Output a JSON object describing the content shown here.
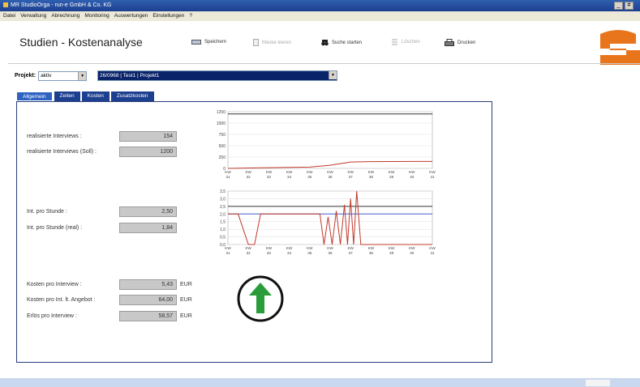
{
  "window": {
    "title": "MR StudioOrga - run-e GmbH & Co. KG",
    "controls": [
      "_",
      "#"
    ]
  },
  "menu": [
    "Datei",
    "Verwaltung",
    "Abrechnung",
    "Monitoring",
    "Auswertungen",
    "Einstellungen",
    "?"
  ],
  "page_title": "Studien - Kostenanalyse",
  "toolbar": {
    "save": "Speichern",
    "clear_mask": "Maske leeren",
    "search": "Suche starten",
    "delete": "Löschen",
    "print": "Drucken"
  },
  "project": {
    "label": "Projekt:",
    "status": "aktiv",
    "selection": "26/0968 | Test1 | Projekt1"
  },
  "tabs": [
    "Allgemein",
    "Zeiten",
    "Kosten",
    "Zusatzkosten"
  ],
  "fields": {
    "interviews_real": {
      "label": "realisierte Interviews :",
      "value": "154"
    },
    "interviews_target": {
      "label": "realisierte Interviews (Soll) :",
      "value": "1200"
    },
    "int_per_hour": {
      "label": "Int. pro Stunde :",
      "value": "2,50"
    },
    "int_per_hour_real": {
      "label": "Int. pro Stunde (real) :",
      "value": "1,84"
    },
    "cost_per_interview": {
      "label": "Kosten pro Interview :",
      "value": "5,43",
      "unit": "EUR"
    },
    "cost_per_offer": {
      "label": "Kosten pro Int. lt. Angebot :",
      "value": "64,00",
      "unit": "EUR"
    },
    "revenue_per_interview": {
      "label": "Erlös pro Interview :",
      "value": "58,57",
      "unit": "EUR"
    }
  },
  "trend_icon": "arrow-up-icon",
  "colors": {
    "accent": "#e8741c",
    "trend": "#2a9d3a",
    "tab": "#1d3f8f"
  },
  "chart_data": [
    {
      "type": "line",
      "categories": [
        "KW 31",
        "KW 32",
        "KW 33",
        "KW 34",
        "KW 35",
        "KW 36",
        "KW 37",
        "KW 38",
        "KW 39",
        "KW 40",
        "KW 41"
      ],
      "x_tick_labels": [
        [
          "KW",
          "31"
        ],
        [
          "KW",
          "32"
        ],
        [
          "KW",
          "33"
        ],
        [
          "KW",
          "34"
        ],
        [
          "KW",
          "35"
        ],
        [
          "KW",
          "36"
        ],
        [
          "KW",
          "37"
        ],
        [
          "KW",
          "38"
        ],
        [
          "KW",
          "39"
        ],
        [
          "KW",
          "40"
        ],
        [
          "KW",
          "41"
        ]
      ],
      "ylim": [
        0,
        1250
      ],
      "yticks": [
        "1250",
        "1000",
        "750",
        "500",
        "250",
        "0"
      ],
      "ytick_values": [
        1250,
        1000,
        750,
        500,
        250,
        0
      ],
      "series": [
        {
          "color": "#333333",
          "values": [
            1200,
            1200,
            1200,
            1200,
            1200,
            1200,
            1200,
            1200,
            1200,
            1200,
            1200
          ]
        },
        {
          "color": "#c0392b",
          "values": [
            0,
            8,
            15,
            22,
            30,
            70,
            140,
            150,
            152,
            154,
            154
          ]
        }
      ]
    },
    {
      "type": "line",
      "categories": [
        "KW 31",
        "KW 32",
        "KW 33",
        "KW 34",
        "KW 35",
        "KW 36",
        "KW 37",
        "KW 38",
        "KW 39",
        "KW 40",
        "KW 41"
      ],
      "x_tick_labels": [
        [
          "KW",
          "31"
        ],
        [
          "KW",
          "32"
        ],
        [
          "KW",
          "33"
        ],
        [
          "KW",
          "34"
        ],
        [
          "KW",
          "35"
        ],
        [
          "KW",
          "36"
        ],
        [
          "KW",
          "37"
        ],
        [
          "KW",
          "38"
        ],
        [
          "KW",
          "39"
        ],
        [
          "KW",
          "40"
        ],
        [
          "KW",
          "41"
        ]
      ],
      "ylim": [
        0,
        3.5
      ],
      "yticks": [
        "3,5",
        "3,0",
        "2,5",
        "2,0",
        "1,5",
        "1,0",
        "0,5",
        "0,0"
      ],
      "ytick_values": [
        3.5,
        3.0,
        2.5,
        2.0,
        1.5,
        1.0,
        0.5,
        0.0
      ],
      "series": [
        {
          "color": "#333333",
          "x": [
            0,
            10
          ],
          "values": [
            2.5,
            2.5
          ]
        },
        {
          "color": "#4a5fc8",
          "x": [
            0,
            10
          ],
          "values": [
            2.0,
            2.0
          ]
        },
        {
          "color": "#c0392b",
          "x": [
            0,
            0.5,
            1,
            1.3,
            1.6,
            4.5,
            4.7,
            4.9,
            5.1,
            5.3,
            5.5,
            5.7,
            5.85,
            6,
            6.15,
            6.3,
            6.5,
            7,
            8,
            9,
            10
          ],
          "values": [
            2.0,
            2.0,
            0,
            0,
            2.0,
            2.0,
            0,
            1.8,
            0,
            2.2,
            0,
            2.6,
            0,
            3.0,
            0,
            3.5,
            0,
            0,
            0,
            0,
            0
          ]
        }
      ]
    }
  ]
}
